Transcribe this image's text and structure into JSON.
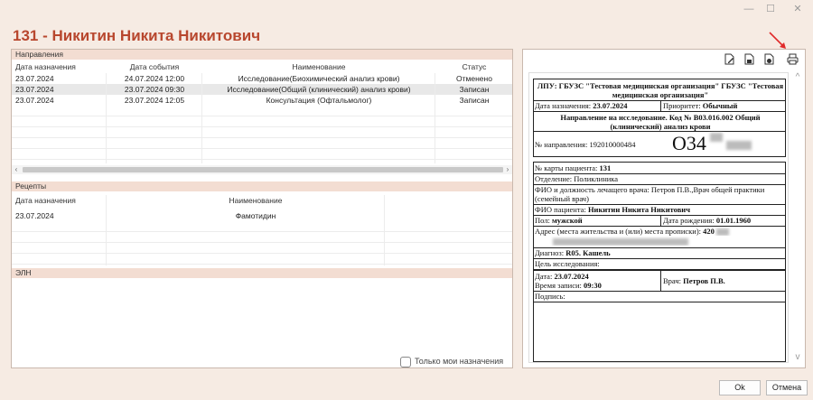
{
  "window": {
    "minimize": "—",
    "maximize": "☐",
    "close": "✕"
  },
  "patient_title": "131 - Никитин Никита Никитович",
  "referrals": {
    "header": "Направления",
    "columns": [
      "Дата назначения",
      "Дата события",
      "Наименование",
      "Статус"
    ],
    "rows": [
      [
        "23.07.2024",
        "24.07.2024 12:00",
        "Исследование(Биохимический анализ крови)",
        "Отменено"
      ],
      [
        "23.07.2024",
        "23.07.2024 09:30",
        "Исследование(Общий (клинический) анализ крови)",
        "Записан"
      ],
      [
        "23.07.2024",
        "23.07.2024 12:05",
        "Консультация (Офтальмолог)",
        "Записан"
      ]
    ]
  },
  "prescriptions": {
    "header": "Рецепты",
    "columns": [
      "Дата назначения",
      "Наименование"
    ],
    "rows": [
      [
        "23.07.2024",
        "Фамотидин"
      ]
    ]
  },
  "eln": {
    "header": "ЭЛН"
  },
  "only_mine_label": "Только мои назначения",
  "toolbar_icons": [
    "edit-doc-icon",
    "save-doc-icon",
    "settings-doc-icon",
    "print-icon"
  ],
  "document": {
    "lpu": "ЛПУ: ГБУЗС \"Тестовая медицинская организация\" ГБУЗС \"Тестовая медицинская организация\"",
    "date_label": "Дата назначения:",
    "date_value": "23.07.2024",
    "priority_label": "Приоритет:",
    "priority_value": "Обычный",
    "title": "Направление на исследование. Код № B03.016.002 Общий (клинический) анализ крови",
    "number_label": "№ направления:",
    "number_value": "192010000484",
    "big_code": "О34",
    "card_label": "№ карты пациента:",
    "card_value": "131",
    "department": "Отделение: Поликлиника",
    "doctor_line": "ФИО и должность лечащего врача: Петров П.В.,Врач общей практики (семейный врач)",
    "patient_label": "ФИО пациента:",
    "patient_value": "Никитин Никита Никитович",
    "sex_label": "Пол:",
    "sex_value": "мужской",
    "dob_label": "Дата рождения:",
    "dob_value": "01.01.1960",
    "address_label": "Адрес (места жительства и (или) места прописки):",
    "address_value": "420",
    "diagnosis_label": "Диагноз:",
    "diagnosis_value": "R05. Кашель",
    "purpose": "Цель исследования:",
    "date2_label": "Дата:",
    "date2_value": "23.07.2024",
    "time_label": "Время записи:",
    "time_value": "09:30",
    "doctor_label": "Врач:",
    "doctor_value": "Петров П.В.",
    "signature": "Подпись:"
  },
  "buttons": {
    "ok": "Ok",
    "cancel": "Отмена"
  }
}
